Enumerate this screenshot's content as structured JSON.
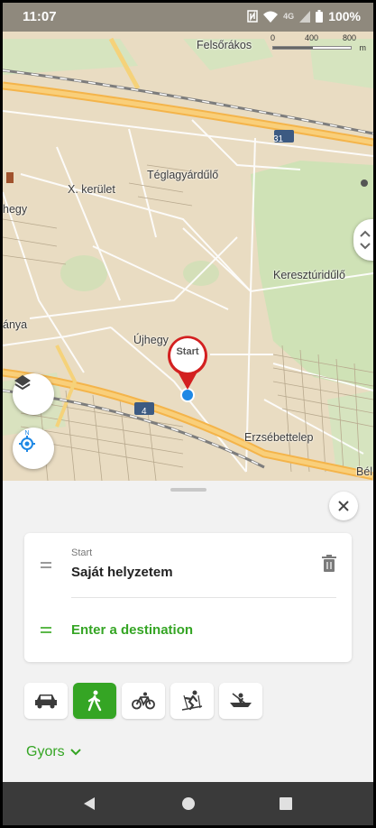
{
  "status_bar": {
    "time": "11:07",
    "icons": [
      "nfc-icon",
      "wifi-icon",
      "signal-4g-icon",
      "battery-icon"
    ],
    "network": "4G",
    "battery": "100%"
  },
  "map": {
    "labels": [
      "Felsőrákos",
      "Téglagyárdűlő",
      "X. kerület",
      "hegy",
      "Keresztúridűlő",
      "Újhegy",
      "ánya",
      "Erzsébettelep",
      "Bél"
    ],
    "road_shields": [
      "31",
      "4"
    ],
    "scale": {
      "ticks": [
        "0",
        "400",
        "800"
      ],
      "unit": "m"
    },
    "pin_label": "Start",
    "colors": {
      "land": "#e9dcc2",
      "park": "#cfe2b6",
      "motorway": "#f4b44a",
      "road": "#ffffff",
      "rail": "#7d7d7d",
      "accent": "#d32020"
    }
  },
  "route": {
    "start_caption": "Start",
    "start_value": "Saját helyzetem",
    "destination_placeholder": "Enter a destination"
  },
  "travel_modes": [
    {
      "name": "car",
      "active": false
    },
    {
      "name": "walk",
      "active": true
    },
    {
      "name": "bicycle",
      "active": false
    },
    {
      "name": "ski",
      "active": false
    },
    {
      "name": "boat",
      "active": false
    }
  ],
  "route_type": "Gyors",
  "theme": {
    "accent": "#35a524"
  }
}
